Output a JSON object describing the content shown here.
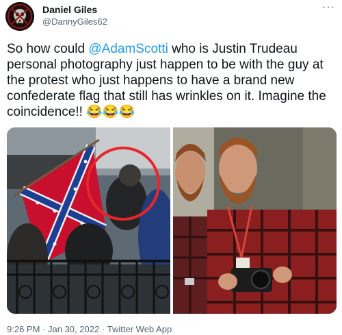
{
  "author": {
    "name": "Daniel Giles",
    "handle": "@DannyGiles62",
    "avatar_icon": "skull-avatar-icon"
  },
  "menu": {
    "more_icon": "more-dots-icon",
    "glyph": "···"
  },
  "tweet": {
    "text_before": "So how could ",
    "mention": "@AdamScotti",
    "text_after": " who is Justin Trudeau personal photography just happen to be with the guy at the protest who just happens to have a brand new confederate flag that still has wrinkles on it. Imagine the coincidence!! ",
    "emoji": "😂😂😂"
  },
  "media": {
    "left_image": "protest-flag-photo",
    "right_image": "two-photographers-photo"
  },
  "footer": {
    "time": "9:26 PM",
    "date": "Jan 30, 2022",
    "source": "Twitter Web App"
  },
  "colors": {
    "link": "#1d9bf0",
    "secondary_text": "#536471",
    "primary_text": "#0f1419"
  }
}
